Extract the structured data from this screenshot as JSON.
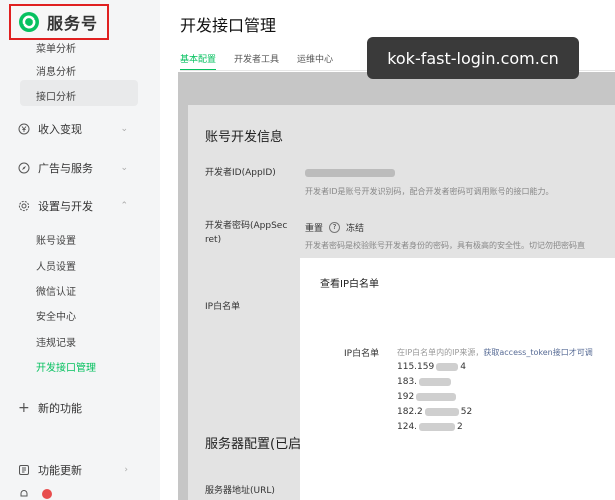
{
  "brand": {
    "name": "服务号",
    "logo_icon": "wechat-service-logo"
  },
  "sidebar": {
    "top_items": [
      {
        "label": "菜单分析"
      },
      {
        "label": "消息分析"
      },
      {
        "label": "接口分析"
      }
    ],
    "groups": {
      "income": {
        "label": "收入变现"
      },
      "ads": {
        "label": "广告与服务"
      },
      "dev": {
        "label": "设置与开发"
      }
    },
    "dev_items": [
      {
        "label": "账号设置"
      },
      {
        "label": "人员设置"
      },
      {
        "label": "微信认证"
      },
      {
        "label": "安全中心"
      },
      {
        "label": "违规记录"
      },
      {
        "label": "开发接口管理"
      }
    ],
    "new_feature": "新的功能",
    "updates": "功能更新"
  },
  "main": {
    "title": "开发接口管理",
    "tabs": [
      {
        "label": "基本配置"
      },
      {
        "label": "开发者工具"
      },
      {
        "label": "运维中心"
      }
    ]
  },
  "watermark": "kok-fast-login.com.cn",
  "dev_info": {
    "title": "账号开发信息",
    "appid_label": "开发者ID(AppID)",
    "appid_desc": "开发者ID是账号开发识别码，配合开发者密码可调用账号的接口能力。",
    "secret_label_1": "开发者密码(AppSec",
    "secret_label_2": "ret)",
    "reset": "重置",
    "help": "?",
    "freeze": "冻结",
    "secret_desc": "开发者密码是校验账号开发者身份的密码，具有极高的安全性。切记勿把密码直",
    "ip_label": "IP白名单"
  },
  "server": {
    "title": "服务器配置(已启",
    "addr_label": "服务器地址(URL)"
  },
  "dialog": {
    "title": "查看IP白名单",
    "label": "IP白名单",
    "desc_prefix": "在IP白名单内的IP来源，",
    "desc_link": "获取access_token接口才可调",
    "ips": [
      {
        "head": "115.159",
        "tail": "4"
      },
      {
        "head": "183.",
        "tail": ""
      },
      {
        "head": "192",
        "tail": ""
      },
      {
        "head": "182.2",
        "tail": "52"
      },
      {
        "head": "124.",
        "tail": "2"
      }
    ]
  }
}
